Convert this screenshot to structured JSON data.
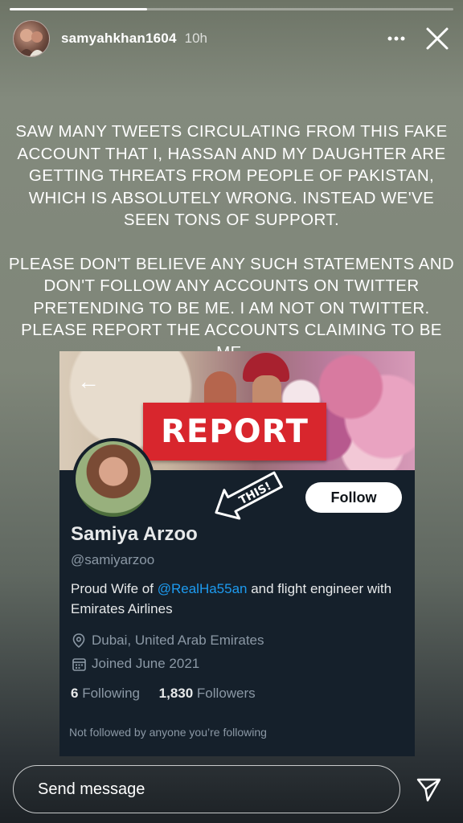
{
  "story": {
    "progress": 0.31,
    "username": "samyahkhan1604",
    "time": "10h",
    "message_paragraphs": [
      "Saw many tweets circulating from this fake account that I, Hassan and my daughter are getting threats from people of Pakistan, which is absolutely wrong. Instead we've seen tons of support.",
      "Please don't believe any such statements and don't follow any accounts on twitter pretending to be me. I am not on twitter. Please report the accounts claiming to be me."
    ]
  },
  "embedded_profile": {
    "report_label": "REPORT",
    "annotation": "THIS!",
    "follow_label": "Follow",
    "name": "Samiya Arzoo",
    "handle": "@samiyarzoo",
    "bio_prefix": "Proud Wife of ",
    "bio_mention": "@RealHa55an",
    "bio_suffix": " and flight engineer with Emirates Airlines",
    "location": "Dubai, United Arab Emirates",
    "joined": "Joined June 2021",
    "following_count": "6",
    "following_label": "Following",
    "followers_count": "1,830",
    "followers_label": "Followers",
    "not_followed": "Not followed by anyone you’re following"
  },
  "footer": {
    "placeholder": "Send message"
  },
  "icons": {
    "more": "more-icon",
    "close": "close-icon",
    "send": "send-icon",
    "location": "location-pin-icon",
    "calendar": "calendar-icon",
    "back": "back-arrow-icon"
  },
  "colors": {
    "twitter_bg": "#15202b",
    "mention_blue": "#1d9bf0",
    "report_red": "#d8262d"
  }
}
